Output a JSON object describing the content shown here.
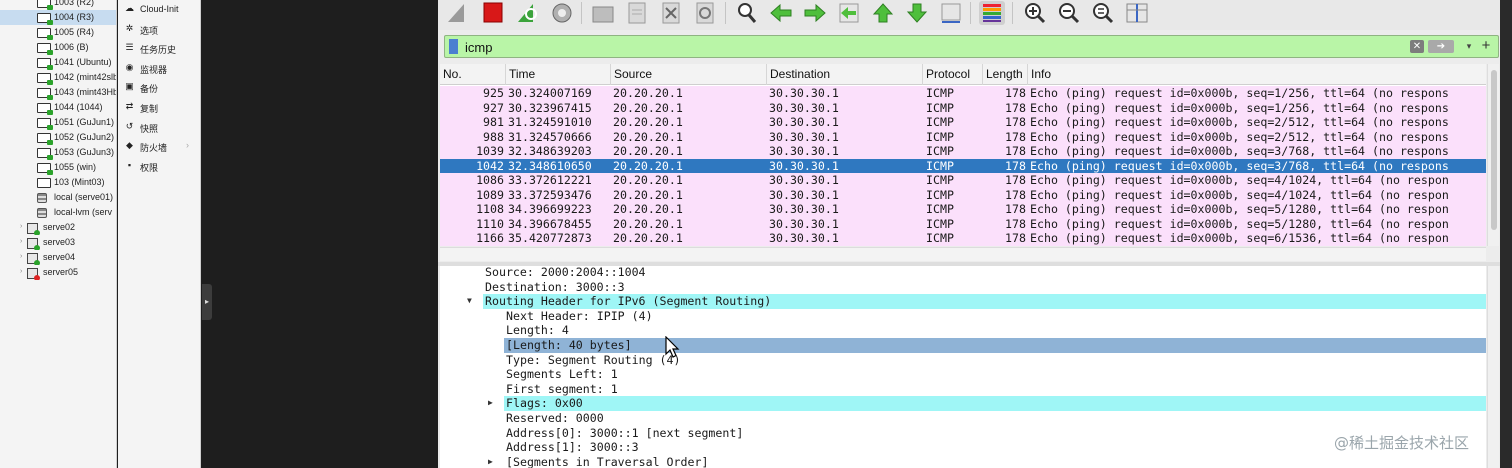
{
  "tree": {
    "items": [
      {
        "label": "1003 (R2)",
        "icon": "vm-running-icon"
      },
      {
        "label": "1004 (R3)",
        "icon": "vm-running-icon",
        "selected": true
      },
      {
        "label": "1005 (R4)",
        "icon": "vm-running-icon"
      },
      {
        "label": "1006 (B)",
        "icon": "vm-running-icon"
      },
      {
        "label": "1041 (Ubuntu)",
        "icon": "vm-running-icon"
      },
      {
        "label": "1042 (mint42slb",
        "icon": "vm-running-icon"
      },
      {
        "label": "1043 (mint43Hb",
        "icon": "vm-running-icon"
      },
      {
        "label": "1044 (1044)",
        "icon": "vm-running-icon"
      },
      {
        "label": "1051 (GuJun1)",
        "icon": "vm-running-icon"
      },
      {
        "label": "1052 (GuJun2)",
        "icon": "vm-running-icon"
      },
      {
        "label": "1053 (GuJun3)",
        "icon": "vm-running-icon"
      },
      {
        "label": "1055 (win)",
        "icon": "vm-running-icon"
      },
      {
        "label": "103 (Mint03)",
        "icon": "vm-stopped-icon"
      },
      {
        "label": "local (serve01)",
        "icon": "storage-icon"
      },
      {
        "label": "local-lvm (serv",
        "icon": "storage-icon"
      }
    ],
    "nodes": [
      {
        "label": "serve02",
        "status": "online"
      },
      {
        "label": "serve03",
        "status": "online"
      },
      {
        "label": "serve04",
        "status": "online"
      },
      {
        "label": "server05",
        "status": "offline"
      }
    ]
  },
  "menu": {
    "items": [
      {
        "label": "Cloud-Init",
        "icon": "cloud-icon"
      },
      {
        "label": "选项",
        "icon": "gear-icon"
      },
      {
        "label": "任务历史",
        "icon": "list-icon"
      },
      {
        "label": "监视器",
        "icon": "eye-icon"
      },
      {
        "label": "备份",
        "icon": "floppy-icon"
      },
      {
        "label": "复制",
        "icon": "retweet-icon"
      },
      {
        "label": "快照",
        "icon": "history-icon"
      },
      {
        "label": "防火墙",
        "icon": "shield-icon",
        "submenu": true
      },
      {
        "label": "权限",
        "icon": "unlock-icon"
      }
    ]
  },
  "filter": {
    "value": "icmp",
    "clear_glyph": "✕",
    "apply_glyph": "➔",
    "dropdown_glyph": "▾",
    "add_glyph": "+"
  },
  "packet_list": {
    "columns": [
      "No.",
      "Time",
      "Source",
      "Destination",
      "Protocol",
      "Length",
      "Info"
    ],
    "rows": [
      {
        "no": "925",
        "time": "30.324007169",
        "source": "20.20.20.1",
        "destination": "30.30.30.1",
        "protocol": "ICMP",
        "length": "178",
        "info": "Echo (ping) request  id=0x000b, seq=1/256, ttl=64 (no respons"
      },
      {
        "no": "927",
        "time": "30.323967415",
        "source": "20.20.20.1",
        "destination": "30.30.30.1",
        "protocol": "ICMP",
        "length": "178",
        "info": "Echo (ping) request  id=0x000b, seq=1/256, ttl=64 (no respons"
      },
      {
        "no": "981",
        "time": "31.324591010",
        "source": "20.20.20.1",
        "destination": "30.30.30.1",
        "protocol": "ICMP",
        "length": "178",
        "info": "Echo (ping) request  id=0x000b, seq=2/512, ttl=64 (no respons"
      },
      {
        "no": "988",
        "time": "31.324570666",
        "source": "20.20.20.1",
        "destination": "30.30.30.1",
        "protocol": "ICMP",
        "length": "178",
        "info": "Echo (ping) request  id=0x000b, seq=2/512, ttl=64 (no respons"
      },
      {
        "no": "1039",
        "time": "32.348639203",
        "source": "20.20.20.1",
        "destination": "30.30.30.1",
        "protocol": "ICMP",
        "length": "178",
        "info": "Echo (ping) request  id=0x000b, seq=3/768, ttl=64 (no respons"
      },
      {
        "no": "1042",
        "time": "32.348610650",
        "source": "20.20.20.1",
        "destination": "30.30.30.1",
        "protocol": "ICMP",
        "length": "178",
        "info": "Echo (ping) request  id=0x000b, seq=3/768, ttl=64 (no respons",
        "selected": true
      },
      {
        "no": "1086",
        "time": "33.372612221",
        "source": "20.20.20.1",
        "destination": "30.30.30.1",
        "protocol": "ICMP",
        "length": "178",
        "info": "Echo (ping) request  id=0x000b, seq=4/1024, ttl=64 (no respon"
      },
      {
        "no": "1089",
        "time": "33.372593476",
        "source": "20.20.20.1",
        "destination": "30.30.30.1",
        "protocol": "ICMP",
        "length": "178",
        "info": "Echo (ping) request  id=0x000b, seq=4/1024, ttl=64 (no respon"
      },
      {
        "no": "1108",
        "time": "34.396699223",
        "source": "20.20.20.1",
        "destination": "30.30.30.1",
        "protocol": "ICMP",
        "length": "178",
        "info": "Echo (ping) request  id=0x000b, seq=5/1280, ttl=64 (no respon"
      },
      {
        "no": "1110",
        "time": "34.396678455",
        "source": "20.20.20.1",
        "destination": "30.30.30.1",
        "protocol": "ICMP",
        "length": "178",
        "info": "Echo (ping) request  id=0x000b, seq=5/1280, ttl=64 (no respon"
      },
      {
        "no": "1166",
        "time": "35.420772873",
        "source": "20.20.20.1",
        "destination": "30.30.30.1",
        "protocol": "ICMP",
        "length": "178",
        "info": "Echo (ping) request  id=0x000b, seq=6/1536, ttl=64 (no respon"
      }
    ]
  },
  "details": {
    "lines": [
      {
        "text": "Source: 2000:2004::1004",
        "indent": 1
      },
      {
        "text": "Destination: 3000::3",
        "indent": 1
      },
      {
        "text": "Routing Header for IPv6 (Segment Routing)",
        "indent": 1,
        "highlight": "cyan",
        "expander": "expanded"
      },
      {
        "text": "Next Header: IPIP (4)",
        "indent": 2
      },
      {
        "text": "Length: 4",
        "indent": 2
      },
      {
        "text": "[Length: 40 bytes]",
        "indent": 2,
        "highlight": "selected"
      },
      {
        "text": "Type: Segment Routing (4)",
        "indent": 2
      },
      {
        "text": "Segments Left: 1",
        "indent": 2
      },
      {
        "text": "First segment: 1",
        "indent": 2
      },
      {
        "text": "Flags: 0x00",
        "indent": 2,
        "highlight": "cyan",
        "expander": "collapsed"
      },
      {
        "text": "Reserved: 0000",
        "indent": 2
      },
      {
        "text": "Address[0]: 3000::1 [next segment]",
        "indent": 2
      },
      {
        "text": "Address[1]: 3000::3",
        "indent": 2
      },
      {
        "text": "[Segments in Traversal Order]",
        "indent": 2,
        "expander": "collapsed"
      }
    ]
  },
  "colors": {
    "row_bg": "#fbe0fb",
    "selected_row_bg": "#2f78c0",
    "filter_bg": "#b9f5a7",
    "detail_highlight": "#9ff6f6",
    "detail_selected": "#8fb3d6"
  },
  "watermark": "@稀土掘金技术社区"
}
